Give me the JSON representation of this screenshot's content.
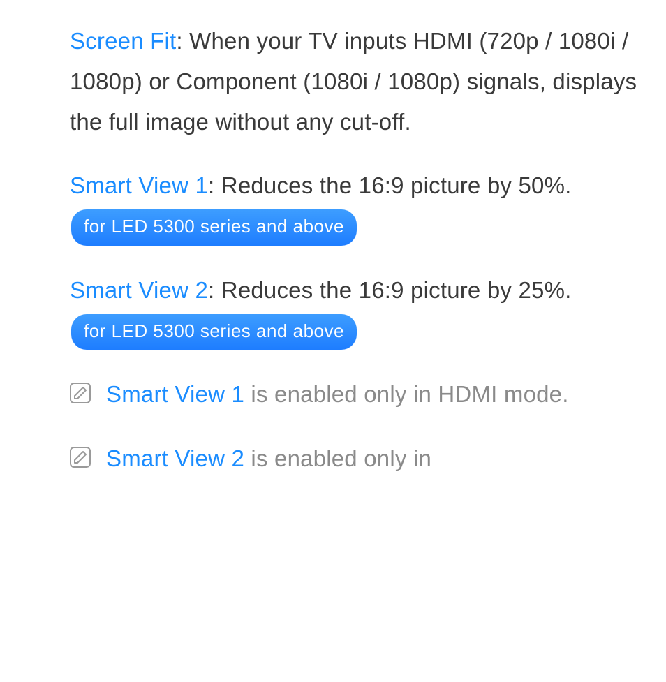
{
  "entries": [
    {
      "term": "Screen Fit",
      "desc": ": When your TV inputs HDMI (720p / 1080i / 1080p) or Component (1080i / 1080p) signals, displays the full image without any cut-off.",
      "badge": null
    },
    {
      "term": "Smart View 1",
      "desc": ": Reduces the 16:9 picture by 50%. ",
      "badge": "for LED 5300 series and above"
    },
    {
      "term": "Smart View 2",
      "desc": ": Reduces the 16:9 picture by 25%. ",
      "badge": "for LED 5300 series and above"
    }
  ],
  "notes": [
    {
      "term": "Smart View 1",
      "rest": " is enabled only in HDMI mode."
    },
    {
      "term": "Smart View 2",
      "rest": " is enabled only in"
    }
  ]
}
